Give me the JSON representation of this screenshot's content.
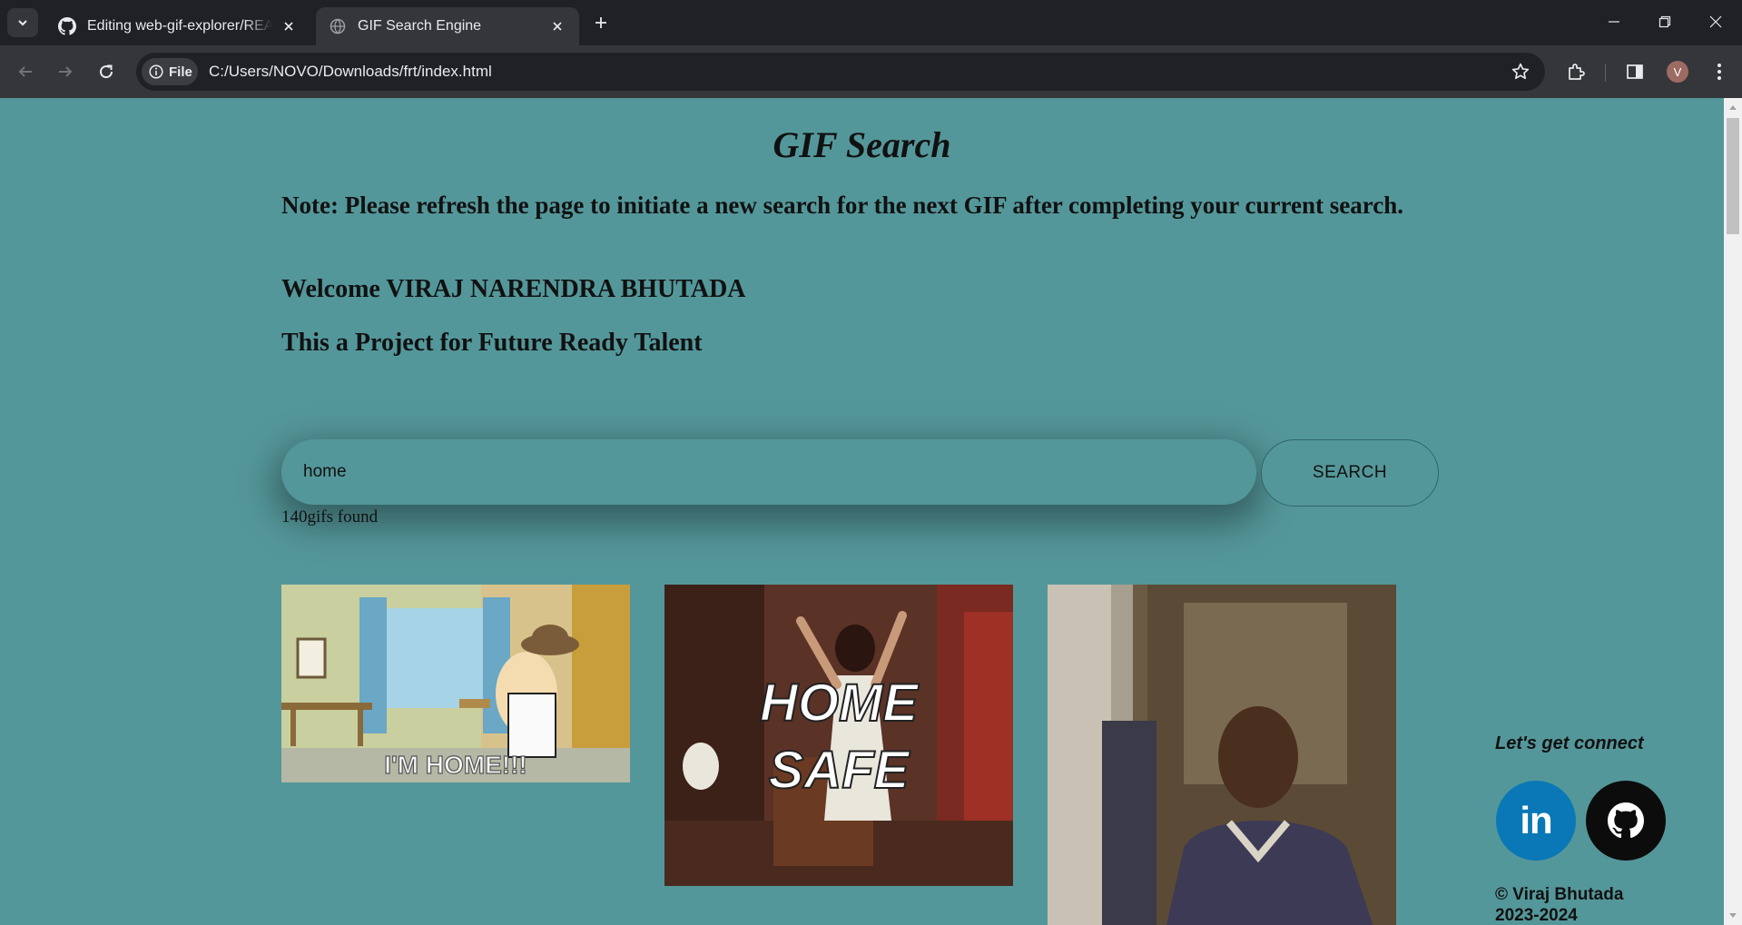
{
  "browser": {
    "tabs": [
      {
        "label": "Editing web-gif-explorer/README.md",
        "favicon": "github-icon",
        "active": false
      },
      {
        "label": "GIF Search Engine",
        "favicon": "globe-icon",
        "active": true
      }
    ],
    "address_chip": "File",
    "url": "C:/Users/NOVO/Downloads/frt/index.html",
    "profile_initial": "V"
  },
  "page": {
    "title": "GIF Search",
    "note": "Note: Please refresh the page to initiate a new search for the next GIF after completing your current search.",
    "welcome": "Welcome VIRAJ NARENDRA BHUTADA",
    "project": "This a Project for Future Ready Talent",
    "search": {
      "value": "home",
      "button_label": "SEARCH"
    },
    "result_count": "140gifs found",
    "gifs": [
      {
        "caption": "I'M HOME!!!"
      },
      {
        "caption_line1": "HOME",
        "caption_line2": "SAFE"
      },
      {
        "caption": ""
      }
    ]
  },
  "footer": {
    "connect": "Let's get connect",
    "linkedin_label": "in",
    "copyright_line1": "© Viraj Bhutada",
    "copyright_line2": "2023-2024"
  },
  "colors": {
    "page_bg": "#54979a",
    "linkedin": "#0a78b6",
    "github": "#0c0c0c",
    "chrome_dark": "#202124",
    "chrome_tab": "#35363a"
  }
}
